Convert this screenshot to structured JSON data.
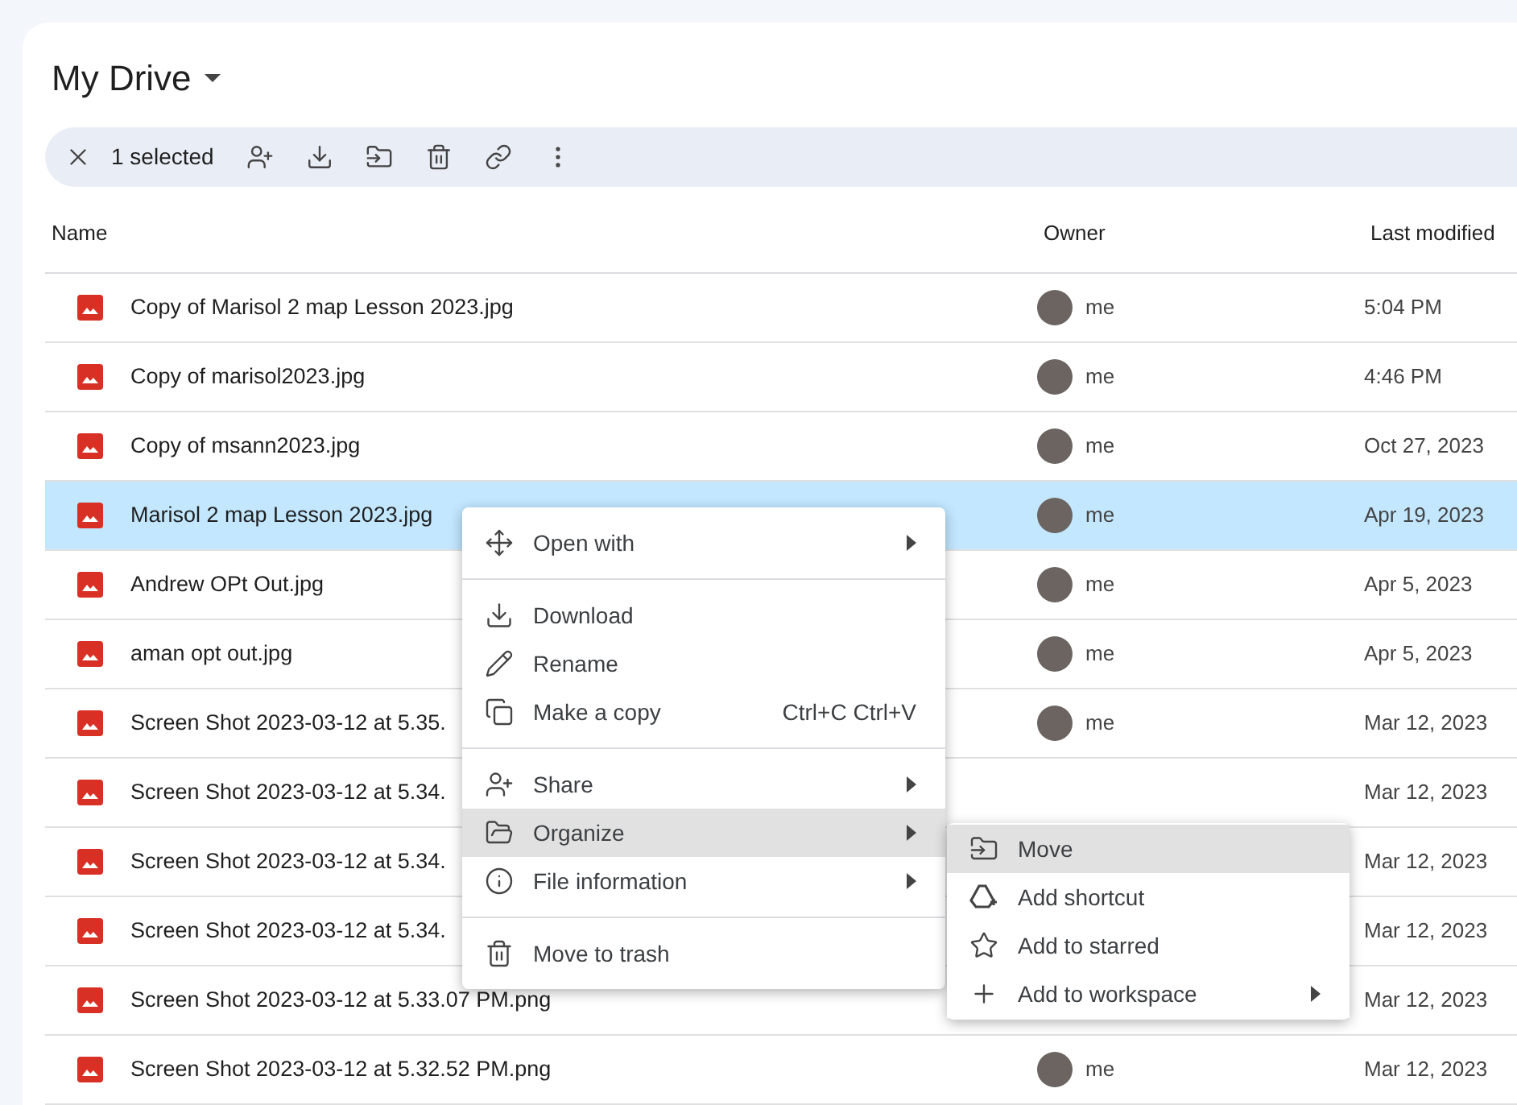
{
  "title": "My Drive",
  "selection_bar": {
    "count_label": "1 selected"
  },
  "table": {
    "columns": [
      "Name",
      "Owner",
      "Last modified"
    ],
    "rows": [
      {
        "name": "Copy of Marisol 2 map Lesson 2023.jpg",
        "owner": "me",
        "modified": "5:04 PM",
        "selected": false
      },
      {
        "name": "Copy of marisol2023.jpg",
        "owner": "me",
        "modified": "4:46 PM",
        "selected": false
      },
      {
        "name": "Copy of msann2023.jpg",
        "owner": "me",
        "modified": "Oct 27, 2023",
        "selected": false
      },
      {
        "name": "Marisol 2 map Lesson 2023.jpg",
        "owner": "me",
        "modified": "Apr 19, 2023",
        "selected": true
      },
      {
        "name": "Andrew OPt Out.jpg",
        "owner": "me",
        "modified": "Apr 5, 2023",
        "selected": false
      },
      {
        "name": "aman opt out.jpg",
        "owner": "me",
        "modified": "Apr 5, 2023",
        "selected": false
      },
      {
        "name": "Screen Shot 2023-03-12 at 5.35.",
        "owner": "me",
        "modified": "Mar 12, 2023",
        "selected": false
      },
      {
        "name": "Screen Shot 2023-03-12 at 5.34.",
        "modified": "Mar 12, 2023",
        "selected": false
      },
      {
        "name": "Screen Shot 2023-03-12 at 5.34.",
        "modified": "Mar 12, 2023",
        "selected": false
      },
      {
        "name": "Screen Shot 2023-03-12 at 5.34.",
        "modified": "Mar 12, 2023",
        "selected": false
      },
      {
        "name": "Screen Shot 2023-03-12 at 5.33.07 PM.png",
        "modified": "Mar 12, 2023",
        "selected": false
      },
      {
        "name": "Screen Shot 2023-03-12 at 5.32.52 PM.png",
        "owner": "me",
        "modified": "Mar 12, 2023",
        "selected": false
      }
    ]
  },
  "context_menu": {
    "groups": [
      [
        {
          "label": "Open with",
          "submenu": true,
          "highlighted": false
        }
      ],
      [
        {
          "label": "Download",
          "submenu": false,
          "highlighted": false
        },
        {
          "label": "Rename",
          "submenu": false,
          "highlighted": false
        },
        {
          "label": "Make a copy",
          "shortcut": "Ctrl+C Ctrl+V",
          "submenu": false,
          "highlighted": false
        }
      ],
      [
        {
          "label": "Share",
          "submenu": true,
          "highlighted": false
        },
        {
          "label": "Organize",
          "submenu": true,
          "highlighted": true
        },
        {
          "label": "File information",
          "submenu": true,
          "highlighted": false
        }
      ],
      [
        {
          "label": "Move to trash",
          "submenu": false,
          "highlighted": false
        }
      ]
    ]
  },
  "submenu": {
    "items": [
      {
        "label": "Move",
        "submenu": false,
        "highlighted": true
      },
      {
        "label": "Add shortcut",
        "submenu": false,
        "highlighted": false
      },
      {
        "label": "Add to starred",
        "submenu": false,
        "highlighted": false
      },
      {
        "label": "Add to workspace",
        "submenu": true,
        "highlighted": false
      }
    ]
  }
}
